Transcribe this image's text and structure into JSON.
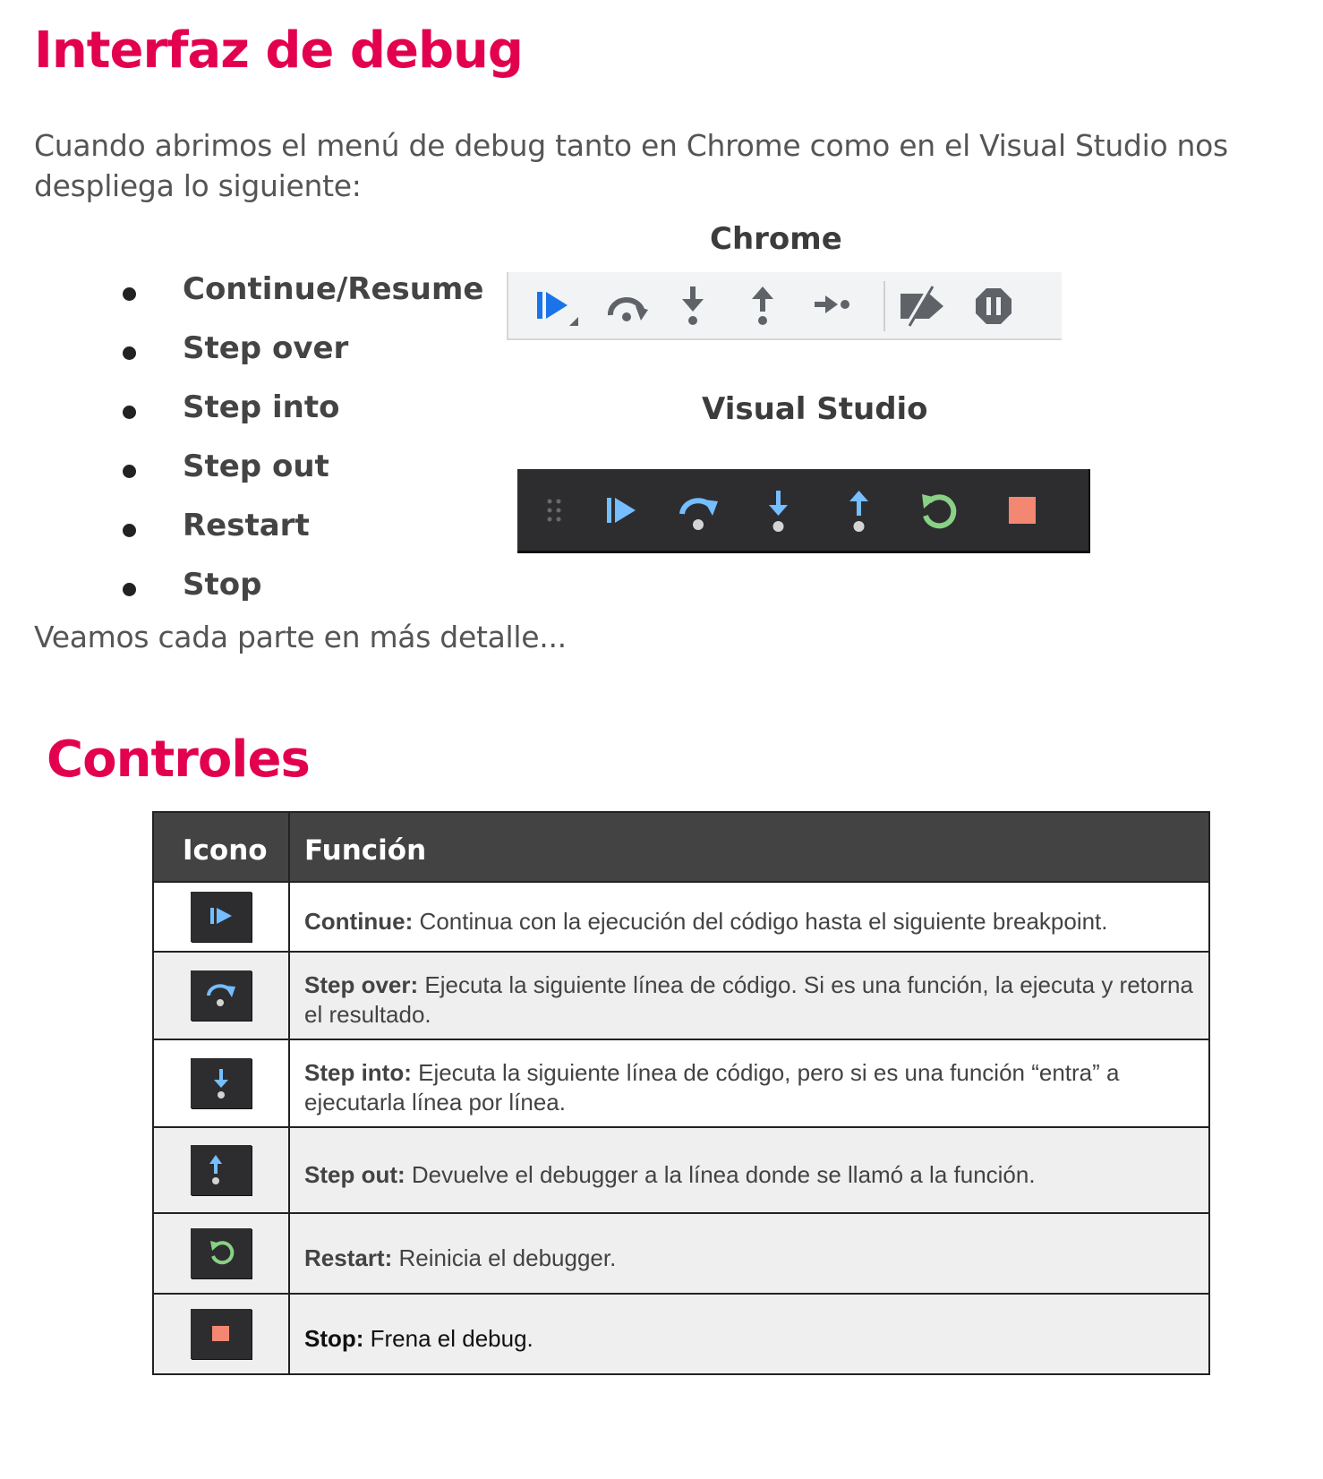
{
  "heading1": "Interfaz de debug",
  "intro": "Cuando abrimos el menú de debug tanto en Chrome como en el Visual Studio nos despliega lo siguiente:",
  "bullets": [
    "Continue/Resume",
    "Step over",
    "Step into",
    "Step out",
    "Restart",
    "Stop"
  ],
  "chrome_label": "Chrome",
  "vs_label": "Visual Studio",
  "outro": "Veamos cada parte en más detalle...",
  "heading2": "Controles",
  "table": {
    "headers": [
      "Icono",
      "Función"
    ],
    "rows": [
      {
        "icon": "continue-icon",
        "term": "Continue:",
        "desc": " Continua con la ejecución del código hasta el siguiente breakpoint."
      },
      {
        "icon": "step-over-icon",
        "term": "Step over:",
        "desc": " Ejecuta la siguiente línea de código. Si es una función, la ejecuta y retorna el resultado."
      },
      {
        "icon": "step-into-icon",
        "term": "Step into:",
        "desc": " Ejecuta la siguiente línea de código, pero si es una función “entra” a ejecutarla línea por línea."
      },
      {
        "icon": "step-out-icon",
        "term": "Step out:",
        "desc": " Devuelve el debugger a la línea donde se llamó a la función."
      },
      {
        "icon": "restart-icon",
        "term": "Restart:",
        "desc": " Reinicia el debugger."
      },
      {
        "icon": "stop-icon",
        "term": "Stop:",
        "desc": " Frena el debug."
      }
    ]
  },
  "colors": {
    "heading": "#e2004f",
    "chrome_icon_blue": "#1a73e8",
    "chrome_icon_gray": "#5f6368",
    "vs_blue": "#75beff",
    "vs_green": "#89d185",
    "vs_stop": "#f48771",
    "vs_bg": "#2d2d30",
    "table_header_bg": "#434343"
  }
}
